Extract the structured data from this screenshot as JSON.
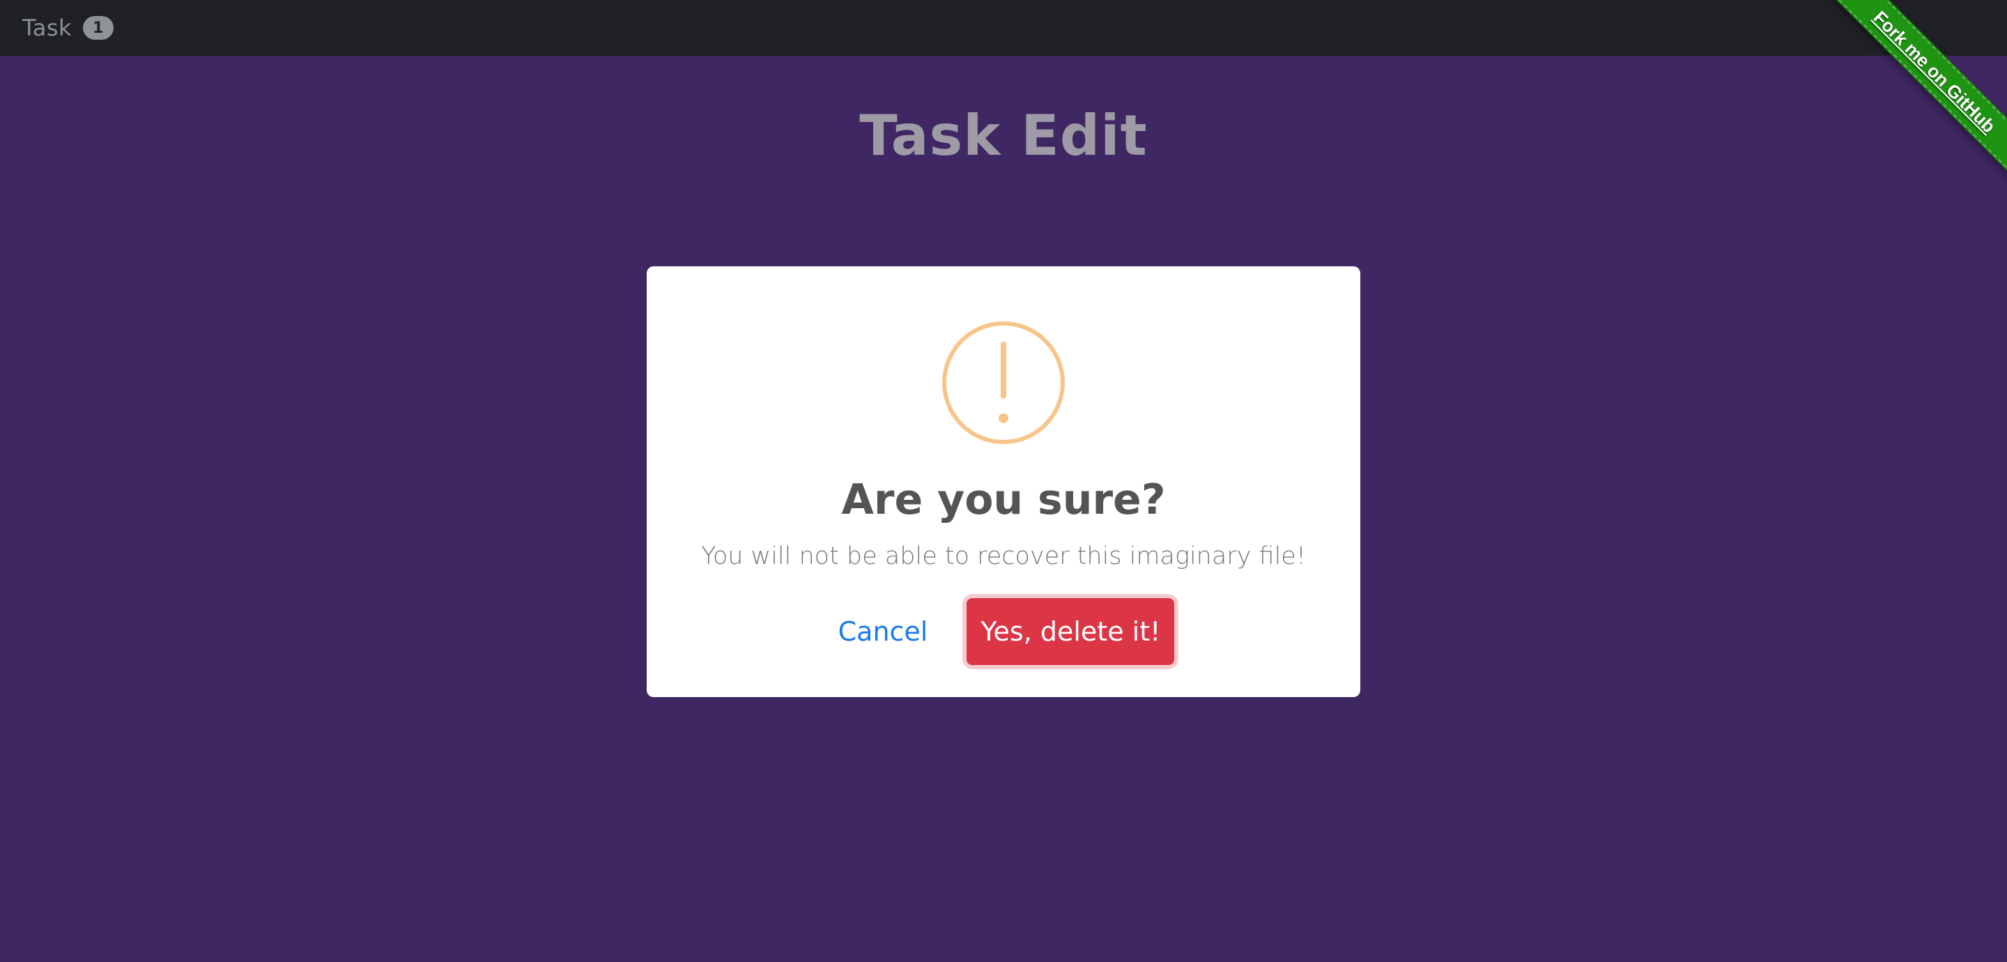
{
  "navbar": {
    "brand_label": "Task",
    "badge_count": "1"
  },
  "ribbon": {
    "label": "Fork me on GitHub",
    "color": "#1f9312"
  },
  "page": {
    "title": "Task Edit",
    "background": "#3e2763"
  },
  "dialog": {
    "icon": "warning-exclamation-icon",
    "icon_color": "#f7c589",
    "title": "Are you sure?",
    "message": "You will not be able to recover this imaginary file!",
    "cancel_label": "Cancel",
    "confirm_label": "Yes, delete it!",
    "confirm_color": "#dc3546",
    "cancel_color": "#1a7ae8"
  }
}
